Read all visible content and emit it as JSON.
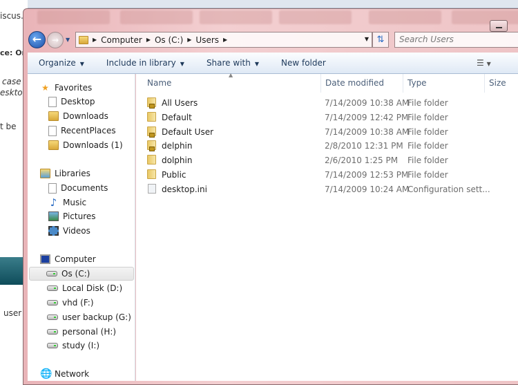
{
  "background": {
    "fragments": [
      "iscus...",
      "ce: Or",
      "case",
      "eskto",
      "t be",
      "user"
    ]
  },
  "window": {
    "minimize": "minimize"
  },
  "address": {
    "crumbs": [
      "Computer",
      "Os (C:)",
      "Users"
    ],
    "search_placeholder": "Search Users"
  },
  "toolbar": {
    "organize": "Organize",
    "include": "Include in library",
    "share": "Share with",
    "new_folder": "New folder"
  },
  "nav": {
    "favorites": {
      "label": "Favorites",
      "items": [
        "Desktop",
        "Downloads",
        "RecentPlaces",
        "Downloads (1)"
      ]
    },
    "libraries": {
      "label": "Libraries",
      "items": [
        "Documents",
        "Music",
        "Pictures",
        "Videos"
      ]
    },
    "computer": {
      "label": "Computer",
      "items": [
        "Os (C:)",
        "Local Disk (D:)",
        "vhd (F:)",
        "user backup (G:)",
        "personal (H:)",
        "study (I:)"
      ],
      "selected": "Os (C:)"
    },
    "network": {
      "label": "Network"
    }
  },
  "columns": [
    "Name",
    "Date modified",
    "Type",
    "Size"
  ],
  "files": [
    {
      "name": "All Users",
      "date": "7/14/2009 10:38 AM",
      "type": "File folder",
      "icon": "locked-folder"
    },
    {
      "name": "Default",
      "date": "7/14/2009 12:42 PM",
      "type": "File folder",
      "icon": "folder"
    },
    {
      "name": "Default User",
      "date": "7/14/2009 10:38 AM",
      "type": "File folder",
      "icon": "locked-folder"
    },
    {
      "name": "delphin",
      "date": "2/8/2010 12:31 PM",
      "type": "File folder",
      "icon": "locked-folder"
    },
    {
      "name": "dolphin",
      "date": "2/6/2010 1:25 PM",
      "type": "File folder",
      "icon": "folder"
    },
    {
      "name": "Public",
      "date": "7/14/2009 12:53 PM",
      "type": "File folder",
      "icon": "folder"
    },
    {
      "name": "desktop.ini",
      "date": "7/14/2009 10:24 AM",
      "type": "Configuration sett...",
      "icon": "settings-file"
    }
  ]
}
